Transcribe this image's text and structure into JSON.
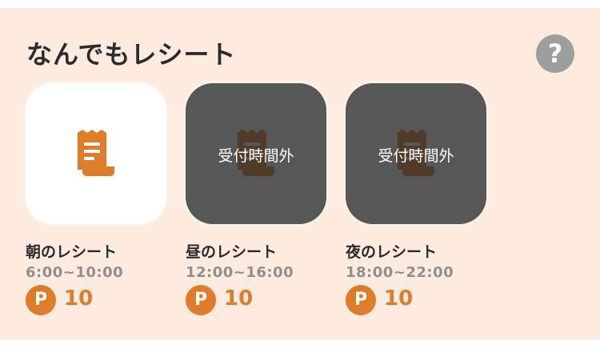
{
  "header": {
    "title": "なんでもレシート",
    "help_symbol": "?"
  },
  "colors": {
    "accent": "#e07b2a",
    "panel_bg": "#fdebe0",
    "disabled_overlay": "#383838",
    "help_bg": "#9e9e9e"
  },
  "receipts": [
    {
      "name": "朝のレシート",
      "hours": "6:00~10:00",
      "point_symbol": "P",
      "points": "10",
      "status": "",
      "icon": "receipt-icon"
    },
    {
      "name": "昼のレシート",
      "hours": "12:00~16:00",
      "point_symbol": "P",
      "points": "10",
      "status": "受付時間外",
      "icon": "receipt-icon"
    },
    {
      "name": "夜のレシート",
      "hours": "18:00~22:00",
      "point_symbol": "P",
      "points": "10",
      "status": "受付時間外",
      "icon": "receipt-icon"
    }
  ]
}
